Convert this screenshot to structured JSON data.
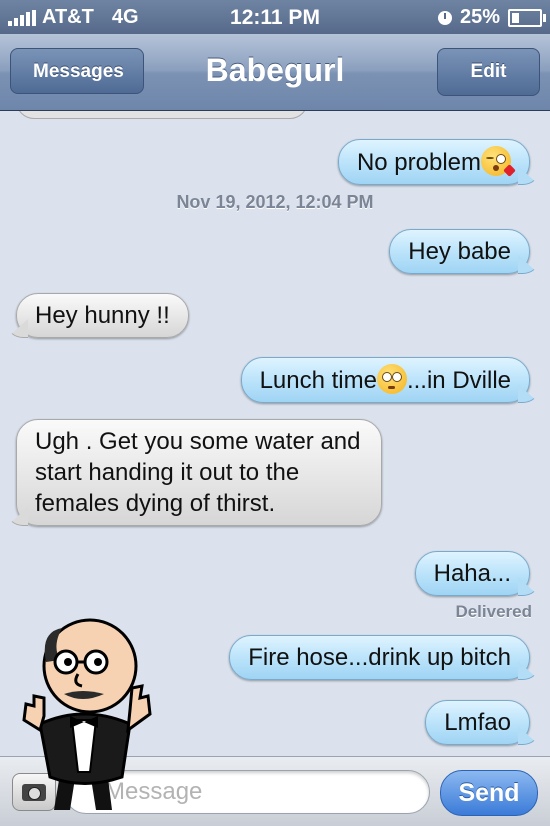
{
  "status_bar": {
    "carrier": "AT&T",
    "network": "4G",
    "time": "12:11 PM",
    "battery": "25%",
    "battery_level": 0.25
  },
  "nav": {
    "back_label": "Messages",
    "title": "Babegurl",
    "edit_label": "Edit"
  },
  "messages": [
    {
      "text": "No problem",
      "direction": "outgoing",
      "emoji": "kissing-heart"
    },
    {
      "text": "Hey babe",
      "direction": "outgoing"
    },
    {
      "text": "Hey hunny !!",
      "direction": "incoming"
    },
    {
      "text": "Lunch time",
      "text_after": "...in Dville",
      "direction": "outgoing",
      "emoji": "flushed"
    },
    {
      "text": "Ugh . Get you some water and start handing it out to the females dying of thirst.",
      "direction": "incoming"
    },
    {
      "text": "Haha...",
      "direction": "outgoing"
    },
    {
      "text": "Fire hose...drink up bitch",
      "direction": "outgoing"
    },
    {
      "text": "Lmfao",
      "direction": "outgoing"
    }
  ],
  "timestamp": "Nov 19, 2012, 12:04 PM",
  "delivered_label": "Delivered",
  "compose": {
    "placeholder": "Message",
    "send_label": "Send"
  },
  "colors": {
    "outgoing_bubble": "#bfe5fb",
    "incoming_bubble": "#e8e8e8",
    "send_button": "#3b7bd8",
    "background": "#dbe2ed"
  }
}
